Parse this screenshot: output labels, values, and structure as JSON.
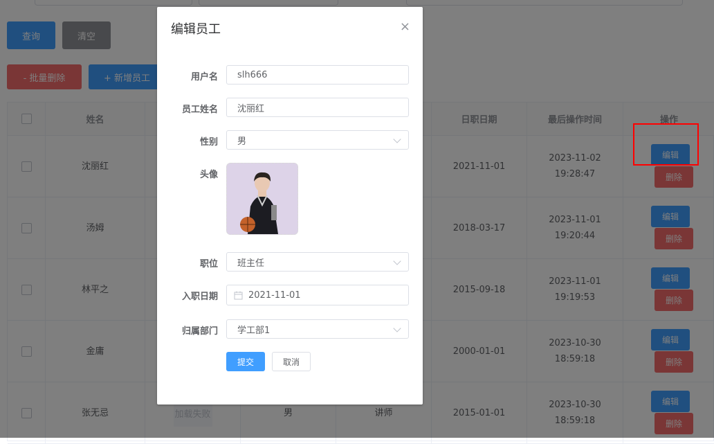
{
  "toolbar": {
    "query_label": "查询",
    "clear_label": "清空",
    "batch_delete_label": "- 批量删除",
    "add_label": "+ 新增员工"
  },
  "table": {
    "headers": {
      "name": "姓名",
      "entry_date": "日职日期",
      "last_op": "最后操作时间",
      "actions": "操作"
    },
    "rows": [
      {
        "name": "沈丽红",
        "entry_date": "2021-11-01",
        "last_op": "2023-11-02 19:28:47"
      },
      {
        "name": "汤姆",
        "entry_date": "2018-03-17",
        "last_op": "2023-11-01 19:20:44"
      },
      {
        "name": "林平之",
        "entry_date": "2015-09-18",
        "last_op": "2023-11-01 19:19:53"
      },
      {
        "name": "金庸",
        "entry_date": "2000-01-01",
        "last_op": "2023-10-30 18:59:18"
      },
      {
        "name": "张无忌",
        "image_text": "加载失败",
        "gender": "男",
        "position": "讲师",
        "entry_date": "2015-01-01",
        "last_op": "2023-10-30 18:59:18"
      }
    ],
    "edit_label": "编辑",
    "delete_label": "删除"
  },
  "dialog": {
    "title": "编辑员工",
    "close_icon": "×",
    "fields": {
      "username": {
        "label": "用户名",
        "value": "slh666"
      },
      "fullname": {
        "label": "员工姓名",
        "value": "沈丽红"
      },
      "gender": {
        "label": "性别",
        "value": "男"
      },
      "avatar": {
        "label": "头像"
      },
      "position": {
        "label": "职位",
        "value": "班主任"
      },
      "entry_date": {
        "label": "入职日期",
        "value": "2021-11-01"
      },
      "department": {
        "label": "归属部门",
        "value": "学工部1"
      }
    },
    "submit_label": "提交",
    "cancel_label": "取消"
  },
  "colors": {
    "primary": "#409eff",
    "danger": "#f56c6c",
    "info": "#909399",
    "highlight": "#ff0000"
  }
}
